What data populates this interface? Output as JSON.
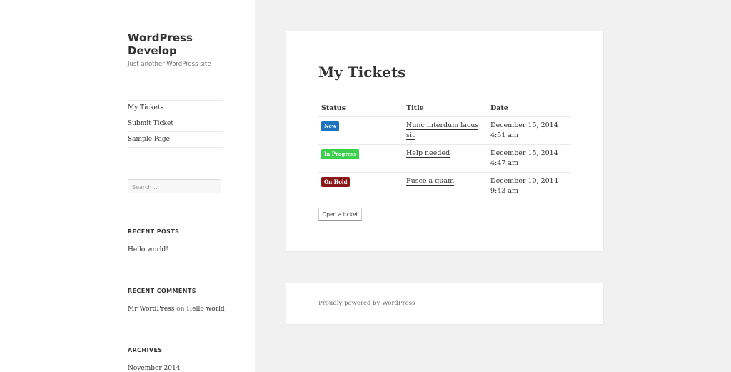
{
  "site": {
    "title": "WordPress Develop",
    "description": "Just another WordPress site"
  },
  "nav": {
    "items": [
      {
        "label": "My Tickets"
      },
      {
        "label": "Submit Ticket"
      },
      {
        "label": "Sample Page"
      }
    ]
  },
  "search": {
    "placeholder": "Search …"
  },
  "widgets": {
    "recent_posts": {
      "title": "RECENT POSTS",
      "items": [
        "Hello world!"
      ]
    },
    "recent_comments": {
      "title": "RECENT COMMENTS",
      "author": "Mr WordPress",
      "on": "on",
      "post": "Hello world!"
    },
    "archives": {
      "title": "ARCHIVES",
      "items": [
        "November 2014"
      ]
    }
  },
  "main": {
    "title": "My Tickets",
    "columns": [
      "Status",
      "Title",
      "Date"
    ],
    "rows": [
      {
        "status": "New",
        "status_color": "#1e73be",
        "title": "Nunc interdum lacus sit",
        "date": "December 15, 2014",
        "time": "4:51 am"
      },
      {
        "status": "In Progress",
        "status_color": "#3ccf4e",
        "title": "Help needed",
        "date": "December 15, 2014",
        "time": "4:47 am"
      },
      {
        "status": "On Hold",
        "status_color": "#8a1818",
        "title": "Fusce a quam",
        "date": "December 10, 2014",
        "time": "9:43 am"
      }
    ],
    "open_ticket_label": "Open a ticket"
  },
  "footer": {
    "text": "Proudly powered by WordPress"
  }
}
